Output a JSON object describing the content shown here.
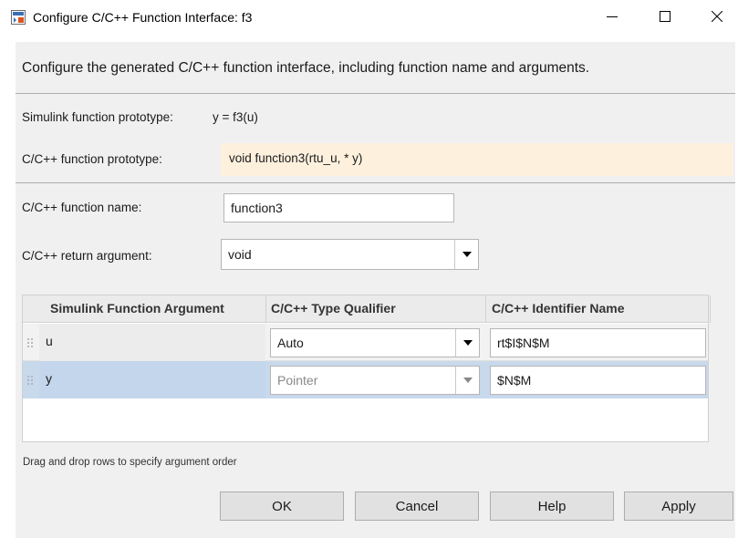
{
  "window": {
    "title": "Configure C/C++ Function Interface: f3",
    "icon": "simulink-app-icon",
    "controls": [
      "minimize-icon",
      "maximize-icon",
      "close-icon"
    ]
  },
  "header": {
    "text": "Configure the generated C/C++ function interface, including function name and arguments."
  },
  "prototypes": {
    "simulink_label": "Simulink function prototype:",
    "simulink_value": "y = f3(u)",
    "cpp_label": "C/C++ function prototype:",
    "cpp_value": "void function3(rtu_u, * y)",
    "cpp_highlight_color": "#fdf1de"
  },
  "form": {
    "name_label": "C/C++ function name:",
    "name_value": "function3",
    "return_label": "C/C++ return argument:",
    "return_value": "void"
  },
  "table": {
    "columns": [
      "Simulink Function Argument",
      "C/C++ Type Qualifier",
      "C/C++ Identifier Name"
    ],
    "rows": [
      {
        "argument": "u",
        "qualifier": "Auto",
        "identifier": "rt$I$N$M",
        "selected": false,
        "qualifier_enabled": true
      },
      {
        "argument": "y",
        "qualifier": "Pointer",
        "identifier": "$N$M",
        "selected": true,
        "qualifier_enabled": false
      }
    ],
    "selected_row_color": "#c8d9ec"
  },
  "hint": "Drag and drop rows to specify argument order",
  "buttons": {
    "ok": "OK",
    "cancel": "Cancel",
    "help": "Help",
    "apply": "Apply"
  }
}
